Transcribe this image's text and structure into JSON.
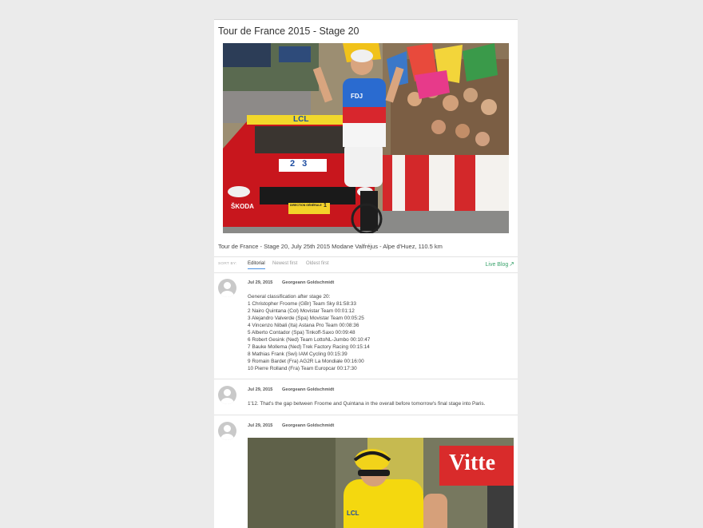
{
  "article": {
    "title": "Tour de France 2015 - Stage 20",
    "hero_image_caption": "Tour de France - Stage 20, July 25th 2015 Modane Valfréjus - Alpe d'Huez, 110.5 km"
  },
  "hero_image": {
    "car_text": "LCL",
    "number_plate": "2 3",
    "brand": "ŠKODA",
    "direction_sign": "DIRECTION GÉNÉRALE",
    "direction_number": "1",
    "rider_jersey": "FDJ"
  },
  "sort_bar": {
    "label": "SORT BY:",
    "options": [
      "Editorial",
      "Newest first",
      "Oldest first"
    ],
    "active": "Editorial",
    "live_blog_label": "Live Blog"
  },
  "posts": [
    {
      "date": "Jul 29, 2015",
      "author": "Georgeann Goldschmidt",
      "lines": [
        "General classification after stage 20:",
        "1 Christopher Froome (GBr) Team Sky 81:58:33",
        "2 Nairo Quintana (Col) Movistar Team 00:01:12",
        "3 Alejandro Valverde (Spa) Movistar Team 00:05:25",
        "4 Vincenzo Nibali (Ita) Astana Pro Team 00:08:36",
        "5 Alberto Contador (Spa) Tinkoff-Saxo 00:09:48",
        "6 Robert Gesink (Ned) Team LottoNL-Jumbo 00:10:47",
        "7 Bauke Mollema (Ned) Trek Factory Racing 00:15:14",
        "8 Mathias Frank (Swi) IAM Cycling 00:15:39",
        "9 Romain Bardet (Fra) AG2R La Mondiale 00:16:00",
        "10 Pierre Rolland (Fra) Team Europcar 00:17:30"
      ]
    },
    {
      "date": "Jul 29, 2015",
      "author": "Georgeann Goldschmidt",
      "lines": [
        "1'12. That's the gap between Froome and Quintana in the overall before tomorrow's final stage into Paris."
      ]
    },
    {
      "date": "Jul 29, 2015",
      "author": "Georgeann Goldschmidt",
      "image": {
        "banner_text": "Vitte",
        "jersey_text": "LCL"
      }
    }
  ],
  "colors": {
    "page_background": "#ebebeb",
    "accent": "#4a90e2",
    "live_blog": "#3aa36c",
    "car_red": "#c8161d",
    "yellow_jersey": "#f4d80f"
  }
}
